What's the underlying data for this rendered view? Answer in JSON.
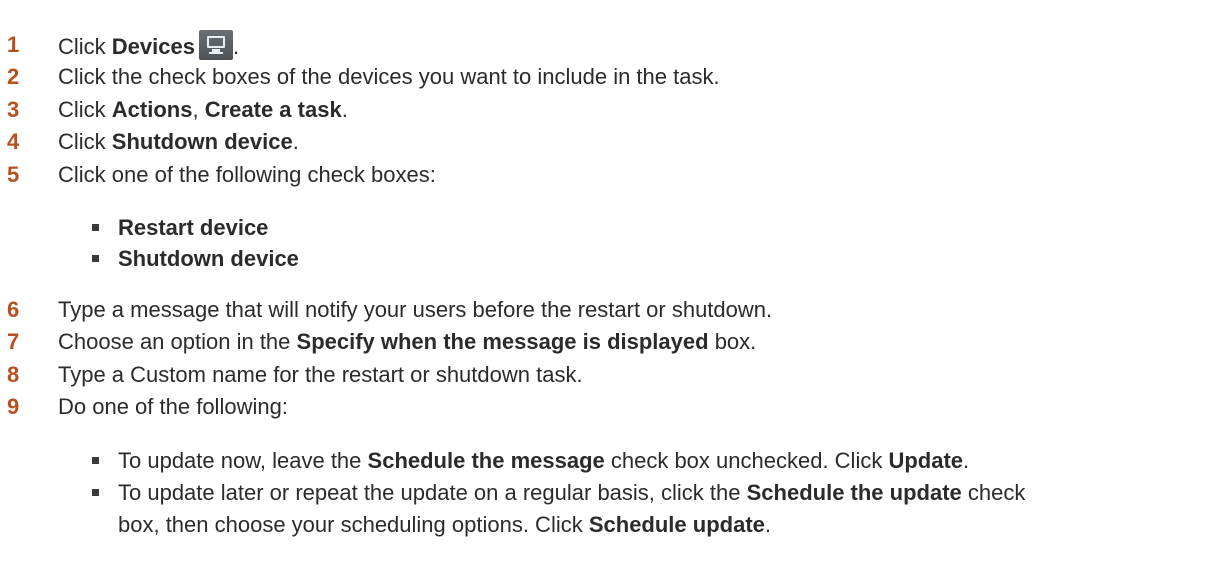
{
  "steps": [
    {
      "num": "1",
      "pre": "Click ",
      "b1": "Devices",
      "post": "."
    },
    {
      "num": "2",
      "text": "Click the check boxes of the devices you want to include in the task."
    },
    {
      "num": "3",
      "pre": "Click ",
      "b1": "Actions",
      "mid": ", ",
      "b2": "Create a task",
      "post": "."
    },
    {
      "num": "4",
      "pre": "Click ",
      "b1": "Shutdown device",
      "post": "."
    },
    {
      "num": "5",
      "text": "Click one of the following check boxes:"
    },
    {
      "num": "6",
      "text": "Type a message that will notify your users before the restart or shutdown."
    },
    {
      "num": "7",
      "pre": "Choose an option in the ",
      "b1": "Specify when the message is displayed",
      "post": " box."
    },
    {
      "num": "8",
      "text": "Type a Custom name for the restart or shutdown task."
    },
    {
      "num": "9",
      "text": "Do one of the following:"
    }
  ],
  "step5_options": [
    "Restart device",
    "Shutdown device"
  ],
  "step9_options": [
    {
      "pre": "To update now, leave the ",
      "b1": "Schedule the message",
      "mid": " check box unchecked. Click ",
      "b2": "Update",
      "post": "."
    },
    {
      "pre": "To update later or repeat the update on a regular basis, click the ",
      "b1": "Schedule the update",
      "post": " check"
    },
    {
      "pre": "box, then choose your scheduling options. Click ",
      "b1": "Schedule update",
      "post": "."
    }
  ],
  "icons": {
    "devices": "monitor-icon"
  },
  "colors": {
    "step_number": "#b5511c",
    "text": "#2b2b2b"
  }
}
